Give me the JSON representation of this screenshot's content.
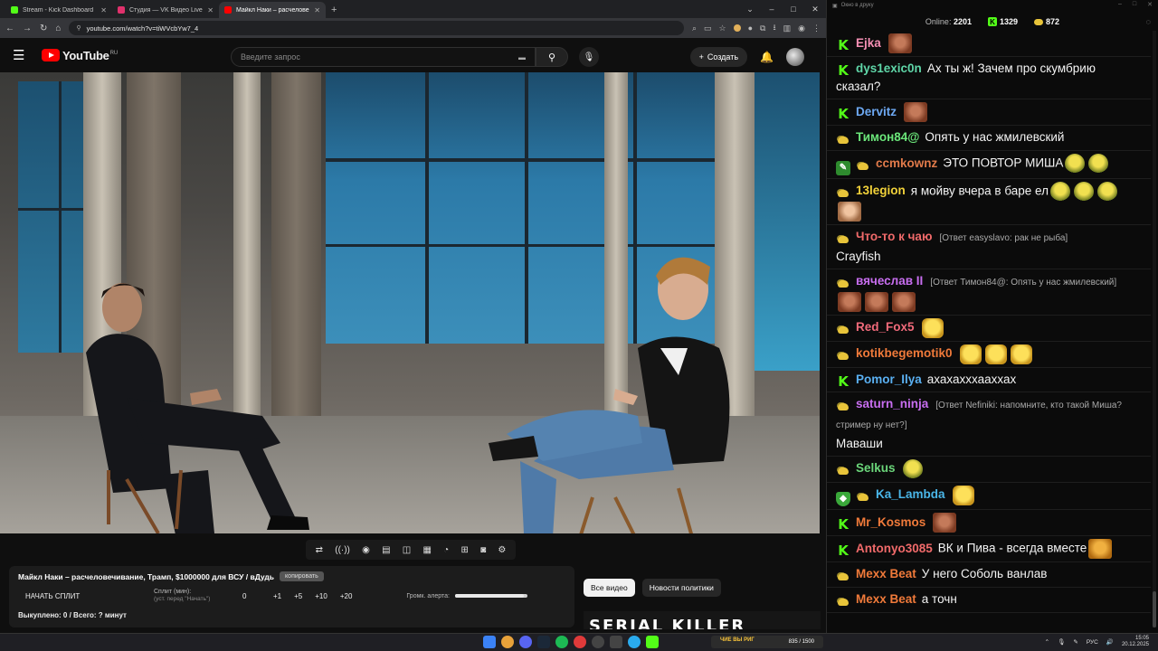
{
  "browser": {
    "tabs": [
      {
        "label": "Stream - Kick Dashboard",
        "fav_color": "#53fc18",
        "active": false
      },
      {
        "label": "Студия — VK Видео Live",
        "fav_color": "#e0316c",
        "active": false
      },
      {
        "label": "Майкл Наки – расчелове",
        "fav_color": "#ff0000",
        "active": true
      }
    ],
    "url": "youtube.com/watch?v=tiWVcbYw7_4"
  },
  "youtube": {
    "logo_text": "YouTube",
    "region": "RU",
    "search_placeholder": "Введите запрос",
    "create_label": "Создать"
  },
  "extension": {
    "video_title": "Майкл Наки – расчеловечивание, Трамп, $1000000 для ВСУ / вДудь",
    "copy_label": "копировать",
    "start_split_label": "НАЧАТЬ СПЛИТ",
    "split_label": "Сплит (мин):",
    "split_sub": "(уст. перед \"Начать\")",
    "split_value": "0",
    "increments": [
      "+1",
      "+5",
      "+10",
      "+20"
    ],
    "alert_volume_label": "Громк. алерта:",
    "alert_volume_fraction": 0.95,
    "footer": "Выкуплено: 0 / Всего: ? минут"
  },
  "chips": {
    "all_videos": "Все видео",
    "politics_news": "Новости политики"
  },
  "thumb_text": "SERIAL KILLER",
  "chat": {
    "window_title": "Окно в друку",
    "online_label": "Online:",
    "online_value": "2201",
    "kick_count": "1329",
    "other_count": "872",
    "messages": [
      {
        "badges": [
          "kick"
        ],
        "user": "Ejka",
        "color": "#f58fb4",
        "text": "",
        "reply": "",
        "tail": "",
        "emotes": [
          "face"
        ]
      },
      {
        "badges": [
          "kick"
        ],
        "user": "dys1exic0n",
        "color": "#5fd6a8",
        "text": "Ах ты ж! Зачем про скумбрию сказал?",
        "reply": "",
        "tail": "",
        "emotes": []
      },
      {
        "badges": [
          "kick"
        ],
        "user": "Dervitz",
        "color": "#6da8f2",
        "text": "",
        "reply": "",
        "tail": "",
        "emotes": [
          "face"
        ]
      },
      {
        "badges": [
          "sub"
        ],
        "user": "Тимон84@",
        "color": "#6be67a",
        "text": "Опять у нас жмилевский",
        "reply": "",
        "tail": "",
        "emotes": []
      },
      {
        "badges": [
          "edit",
          "sub"
        ],
        "user": "ccmkownz",
        "color": "#e07a4a",
        "text": "ЭТО ПОВТОР МИША",
        "reply": "",
        "tail": "",
        "emotes": [
          "pepe",
          "pepe"
        ]
      },
      {
        "badges": [
          "sub"
        ],
        "user": "13legion",
        "color": "#f2d23a",
        "text": "я мойву   вчера   в баре  ел",
        "reply": "",
        "tail": "",
        "emotes": [
          "pepe",
          "pepe",
          "pepe",
          "cat"
        ]
      },
      {
        "badges": [
          "sub"
        ],
        "user": "Что-то к чаю",
        "color": "#f06a6a",
        "text": "",
        "reply": "[Ответ easyslavo: рак не рыба]",
        "tail": "Crayfish",
        "emotes": []
      },
      {
        "badges": [
          "sub"
        ],
        "user": "вячеслав II",
        "color": "#c86ef0",
        "text": "",
        "reply": "[Ответ Тимон84@: Опять у нас жмилевский]",
        "tail": "",
        "emotes": [
          "face",
          "face",
          "face"
        ]
      },
      {
        "badges": [
          "sub"
        ],
        "user": "Red_Fox5",
        "color": "#f06a7a",
        "text": "",
        "reply": "",
        "tail": "",
        "emotes": [
          "laugh"
        ]
      },
      {
        "badges": [
          "sub"
        ],
        "user": "kotikbegemotik0",
        "color": "#f07a3a",
        "text": "",
        "reply": "",
        "tail": "",
        "emotes": [
          "laugh",
          "laugh",
          "laugh"
        ]
      },
      {
        "badges": [
          "kick"
        ],
        "user": "Pomor_Ilya",
        "color": "#5ab0f2",
        "text": "ахахахххааххах",
        "reply": "",
        "tail": "",
        "emotes": []
      },
      {
        "badges": [
          "sub"
        ],
        "user": "saturn_ninja",
        "color": "#c86ef0",
        "text": "",
        "reply": "[Ответ Nefiniki: напомните, кто такой Миша? стример ну нет?]",
        "tail": "Маваши",
        "emotes": []
      },
      {
        "badges": [
          "sub"
        ],
        "user": "Selkus",
        "color": "#6bd67a",
        "text": "",
        "reply": "",
        "tail": "",
        "emotes": [
          "pepe"
        ]
      },
      {
        "badges": [
          "shield",
          "sub"
        ],
        "user": "Ka_Lambda",
        "color": "#4ab6e8",
        "text": "",
        "reply": "",
        "tail": "",
        "emotes": [
          "laugh"
        ]
      },
      {
        "badges": [
          "kick"
        ],
        "user": "Mr_Kosmos",
        "color": "#f07a3a",
        "text": "",
        "reply": "",
        "tail": "",
        "emotes": [
          "face"
        ]
      },
      {
        "badges": [
          "kick"
        ],
        "user": "Antonyo3085",
        "color": "#f06a6a",
        "text": "ВК и Пива - всегда вместе",
        "reply": "",
        "tail": "",
        "emotes": [
          "doge"
        ]
      },
      {
        "badges": [
          "sub"
        ],
        "user": "Mexx Beat",
        "color": "#f07a3a",
        "text": "У него Соболь ванлав",
        "reply": "",
        "tail": "",
        "emotes": []
      },
      {
        "badges": [
          "sub"
        ],
        "user": "Mexx Beat",
        "color": "#f07a3a",
        "text": "а точн",
        "reply": "",
        "tail": "",
        "emotes": []
      }
    ]
  },
  "taskbar": {
    "widget_label": "ЧИЕ ВЫ РИГ",
    "widget_value": "835 / 1500",
    "lang": "РУС",
    "time": "15:05",
    "date": "20.12.2025"
  }
}
